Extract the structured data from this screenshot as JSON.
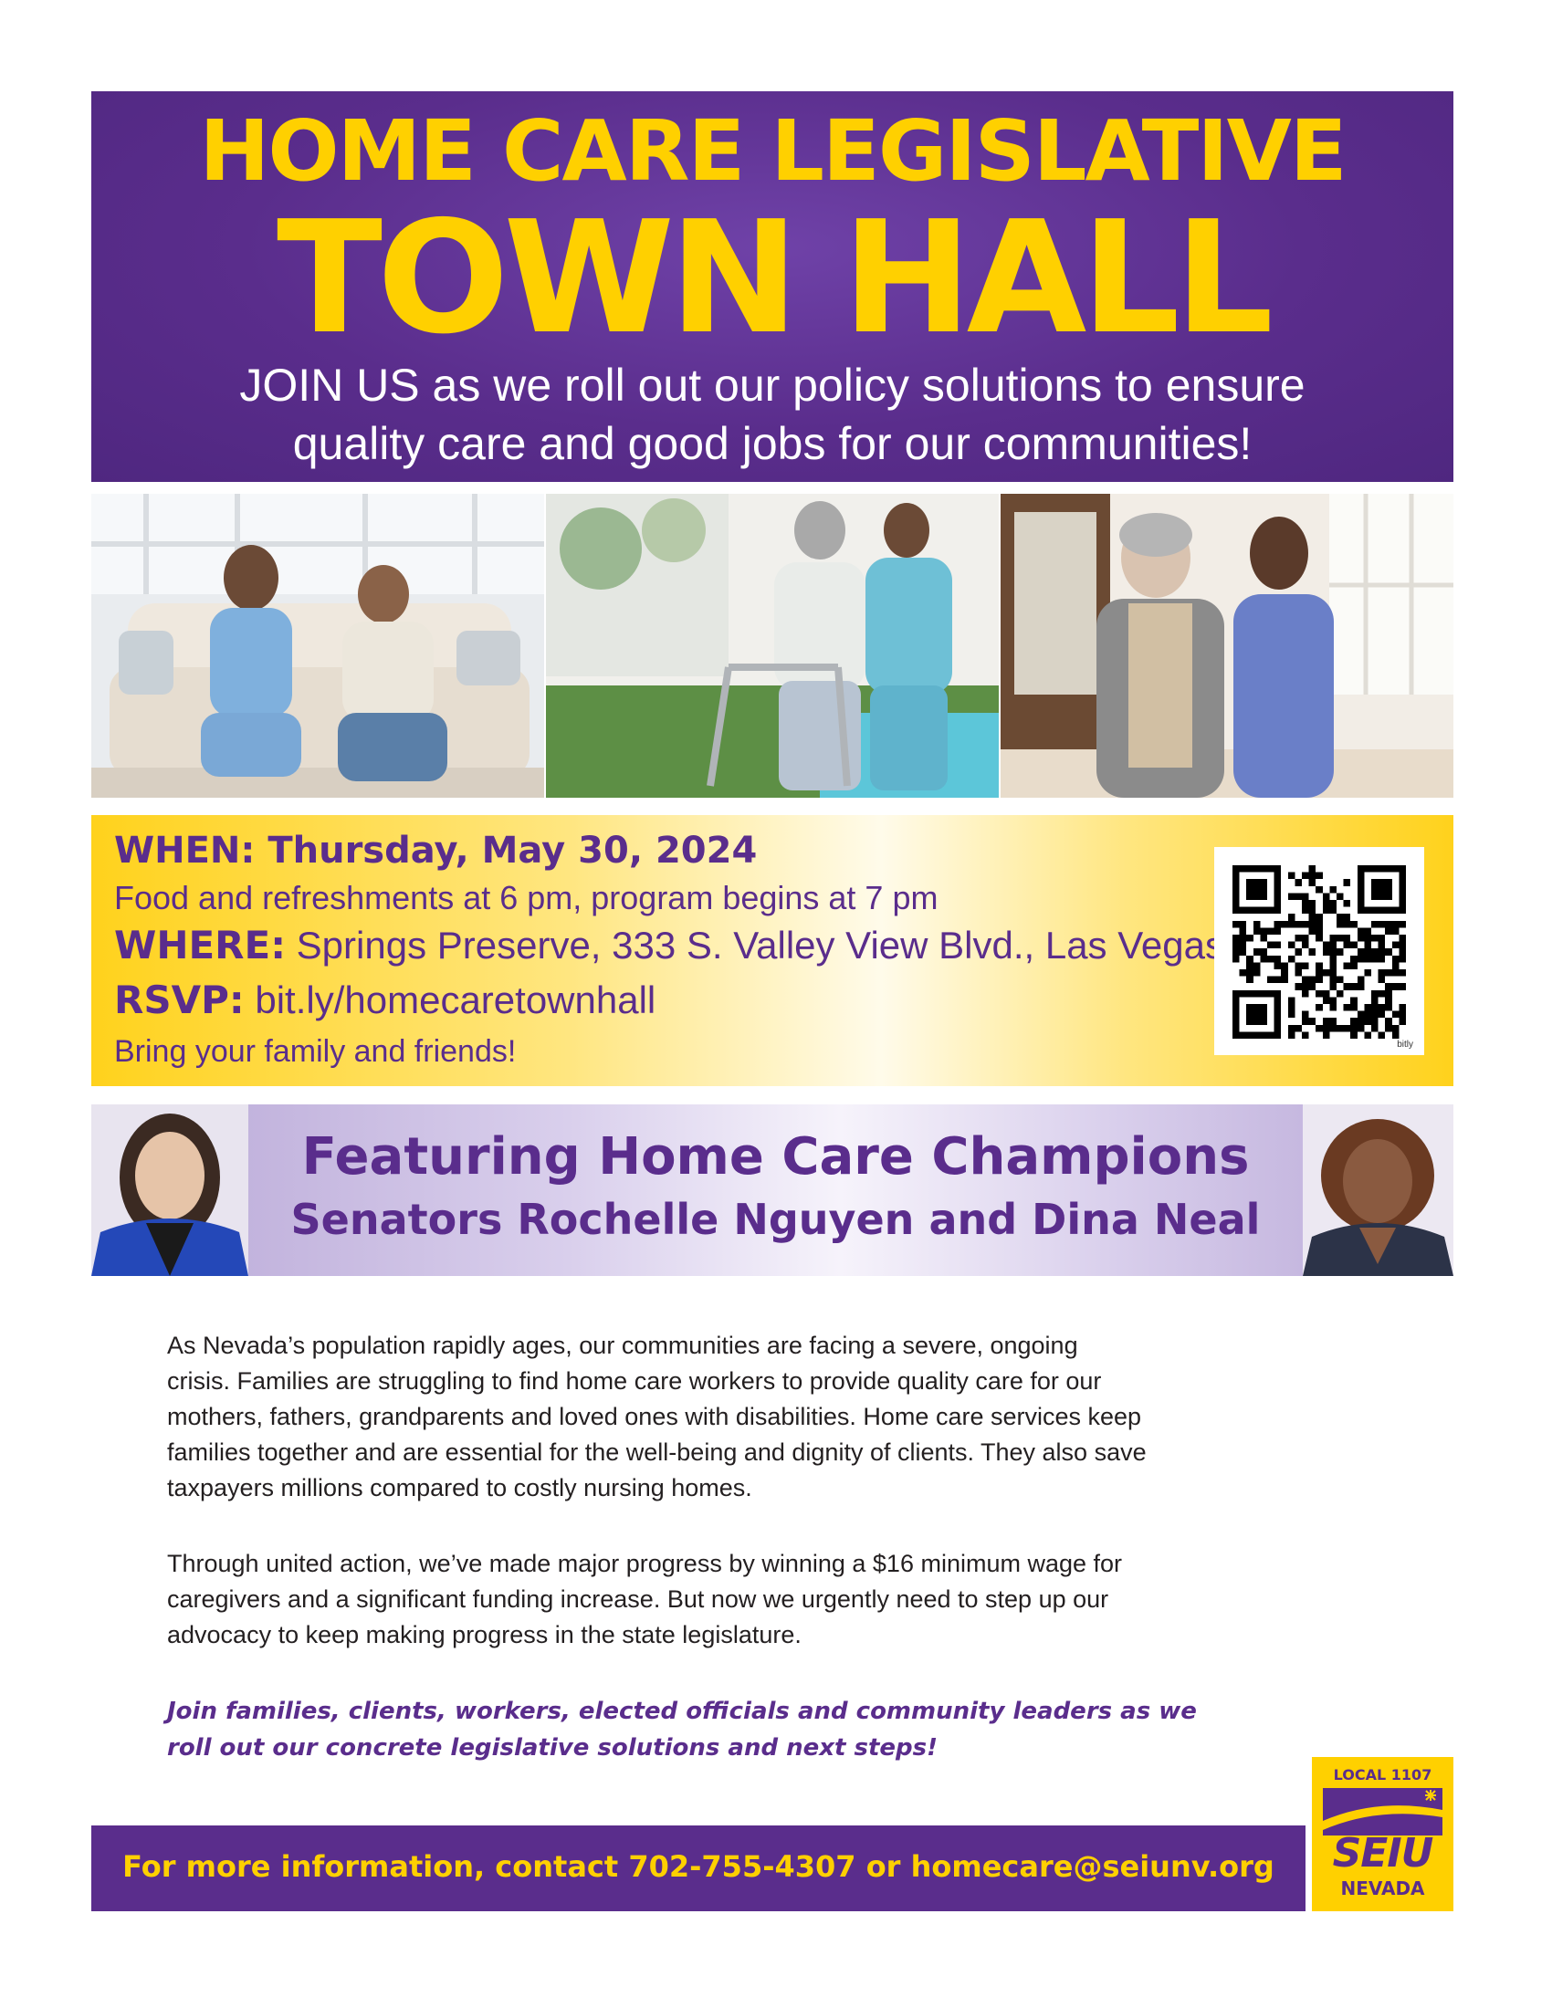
{
  "colors": {
    "purple": "#5a2d8c",
    "yellow": "#ffd000",
    "white": "#ffffff",
    "body_text": "#231f20"
  },
  "header": {
    "title_line1": "HOME CARE LEGISLATIVE",
    "title_line2": "TOWN HALL",
    "subtitle_line1": "JOIN US as we roll out our policy solutions to ensure",
    "subtitle_line2": "quality care and good jobs for our communities!"
  },
  "photos": [
    {
      "icon": "caregiver-with-client-on-sofa-photo"
    },
    {
      "icon": "caregiver-helping-client-with-walker-photo"
    },
    {
      "icon": "caregiver-walking-with-elderly-man-photo"
    }
  ],
  "details": {
    "when_label": "WHEN:",
    "when_value": "Thursday, May 30, 2024",
    "food": "Food and refreshments at 6 pm, program begins at 7 pm",
    "where_label": "WHERE:",
    "where_value": "Springs Preserve, 333 S. Valley View Blvd., Las Vegas",
    "rsvp_label": "RSVP:",
    "rsvp_value": "bit.ly/homecaretownhall",
    "bring": "Bring your family and friends!",
    "qr_brand": "bitly"
  },
  "featuring": {
    "title": "Featuring Home Care Champions",
    "subtitle": "Senators Rochelle Nguyen and Dina Neal"
  },
  "body": {
    "paragraph_1_lines": [
      "As Nevada’s population rapidly ages, our communities are facing a severe, ongoing",
      "crisis. Families are struggling to find home care workers to provide quality care for our",
      "mothers, fathers, grandparents and loved ones with disabilities. Home care services keep",
      "families together and are essential for the well-being and dignity of clients. They also save",
      "taxpayers millions compared to costly nursing homes."
    ],
    "paragraph_2_lines": [
      "Through united action, we’ve made major progress by winning a $16 minimum wage for",
      "caregivers and a significant funding increase. But now we urgently need to step up our",
      "advocacy to keep making progress in the state legislature."
    ],
    "paragraph_3_lines": [
      "Join families, clients, workers, elected officials and community leaders as we",
      "roll out our concrete legislative solutions and next steps!"
    ]
  },
  "footer": {
    "contact": "For more information, contact 702-755-4307 or homecare@seiunv.org"
  },
  "logo": {
    "local": "LOCAL 1107",
    "seiu": "SEIU",
    "nevada": "NEVADA"
  }
}
